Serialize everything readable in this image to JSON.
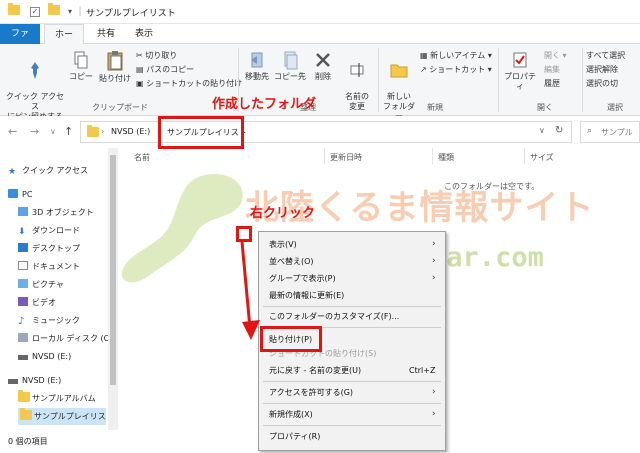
{
  "window": {
    "title": "サンプルプレイリスト"
  },
  "menu": {
    "file": "ファイル",
    "home": "ホーム",
    "share": "共有",
    "view": "表示"
  },
  "ribbon": {
    "pin": "クイック アクセス\nにピン留めする",
    "copy": "コピー",
    "paste": "貼り付け",
    "cut": "切り取り",
    "copy_path": "パスのコピー",
    "paste_shortcut": "ショートカットの貼り付け",
    "group_clipboard": "クリップボード",
    "move_to": "移動先",
    "copy_to": "コピー先",
    "delete": "削除",
    "rename": "名前の\n変更",
    "group_organize": "整理",
    "new_folder": "新しい\nフォルダー",
    "new_item": "新しいアイテム",
    "shortcut": "ショートカット",
    "group_new": "新規",
    "properties": "プロパティ",
    "open": "開く",
    "edit": "編集",
    "history": "履歴",
    "group_open": "開く",
    "select_all": "すべて選択",
    "select_none": "選択解除",
    "invert_selection": "選択の切",
    "group_select": "選択"
  },
  "address": {
    "drive": "NVSD (E:)",
    "folder": "サンプルプレイリスト",
    "search_placeholder": "サンプル"
  },
  "nav": {
    "quick_access": "クイック アクセス",
    "pc": "PC",
    "objects3d": "3D オブジェクト",
    "downloads": "ダウンロード",
    "desktop": "デスクトップ",
    "documents": "ドキュメント",
    "pictures": "ピクチャ",
    "videos": "ビデオ",
    "music": "ミュージック",
    "local_disk": "ローカル ディスク (C:)",
    "nvsd1": "NVSD (E:)",
    "nvsd2": "NVSD (E:)",
    "album": "サンプルアルバム",
    "playlist": "サンプルプレイリスト"
  },
  "columns": {
    "name": "名前",
    "date": "更新日時",
    "type": "種類",
    "size": "サイズ"
  },
  "empty_text": "このフォルダーは空です。",
  "status": {
    "count": "0 個の項目"
  },
  "context_menu": {
    "view": "表示(V)",
    "sort": "並べ替え(O)",
    "group": "グループで表示(P)",
    "refresh": "最新の情報に更新(E)",
    "customize": "このフォルダーのカスタマイズ(F)...",
    "paste": "貼り付け(P)",
    "paste_shortcut": "ショートカットの貼り付け(S)",
    "undo": "元に戻す - 名前の変更(U)",
    "undo_shortcut": "Ctrl+Z",
    "grant_access": "アクセスを許可する(G)",
    "new": "新規作成(X)",
    "properties": "プロパティ(R)"
  },
  "annotations": {
    "created_folder": "作成したフォルダ",
    "right_click": "右クリック",
    "watermark_title": "北陸くるま情報サイト",
    "watermark_url": "hokurikucar.com"
  },
  "colors": {
    "accent": "#1979ca",
    "annotation_red": "#e21515",
    "folder": "#f4c84a"
  }
}
